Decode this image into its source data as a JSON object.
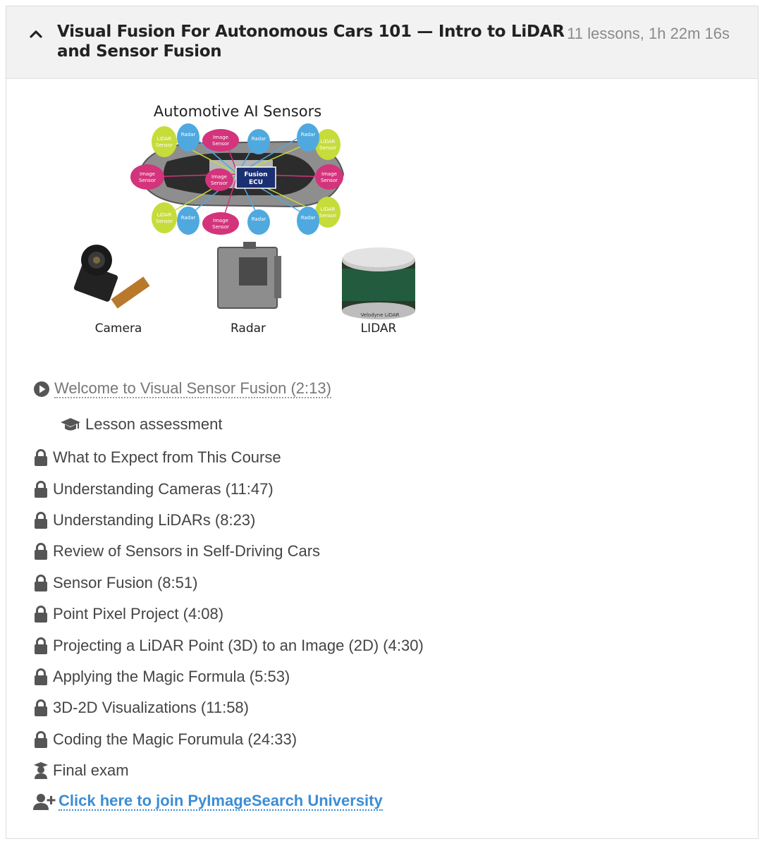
{
  "header": {
    "title": "Visual Fusion For Autonomous Cars 101 — Intro to LiDAR and Sensor Fusion",
    "meta": "11 lessons, 1h 22m 16s"
  },
  "figure": {
    "title": "Automotive AI Sensors",
    "ecu_label_1": "Fusion",
    "ecu_label_2": "ECU",
    "lidar_label_1": "LiDAR",
    "radar_label_1": "Radar",
    "image_label_1": "Image",
    "sensor_word": "Sensor",
    "camera_label": "Camera",
    "radar_label": "Radar",
    "lidar_label": "LIDAR",
    "velodyne_label": "Velodyne LiDAR"
  },
  "lessons": {
    "welcome": "Welcome to Visual Sensor Fusion (2:13)",
    "assessment": "Lesson assessment",
    "l1": "What to Expect from This Course",
    "l2": "Understanding Cameras (11:47)",
    "l3": "Understanding LiDARs (8:23)",
    "l4": "Review of Sensors in Self-Driving Cars",
    "l5": "Sensor Fusion (8:51)",
    "l6": "Point Pixel Project (4:08)",
    "l7": "Projecting a LiDAR Point (3D) to an Image (2D) (4:30)",
    "l8": "Applying the Magic Formula (5:53)",
    "l9": "3D-2D Visualizations (11:58)",
    "l10": "Coding the Magic Forumula (24:33)",
    "final_exam": "Final exam",
    "join": "Click here to join PyImageSearch University"
  },
  "icons": {
    "collapse": "chevron-up-icon",
    "play": "play-circle-icon",
    "assessment": "graduation-cap-icon",
    "locked": "lock-icon",
    "exam": "user-graduate-icon",
    "join": "user-plus-icon"
  },
  "colors": {
    "header_bg": "#f2f2f2",
    "link_blue": "#3b8dd6",
    "lidar_green": "#c6dc3a",
    "radar_blue": "#4fa9df",
    "image_pink": "#d3347c",
    "ecu_navy": "#1b2f73"
  }
}
